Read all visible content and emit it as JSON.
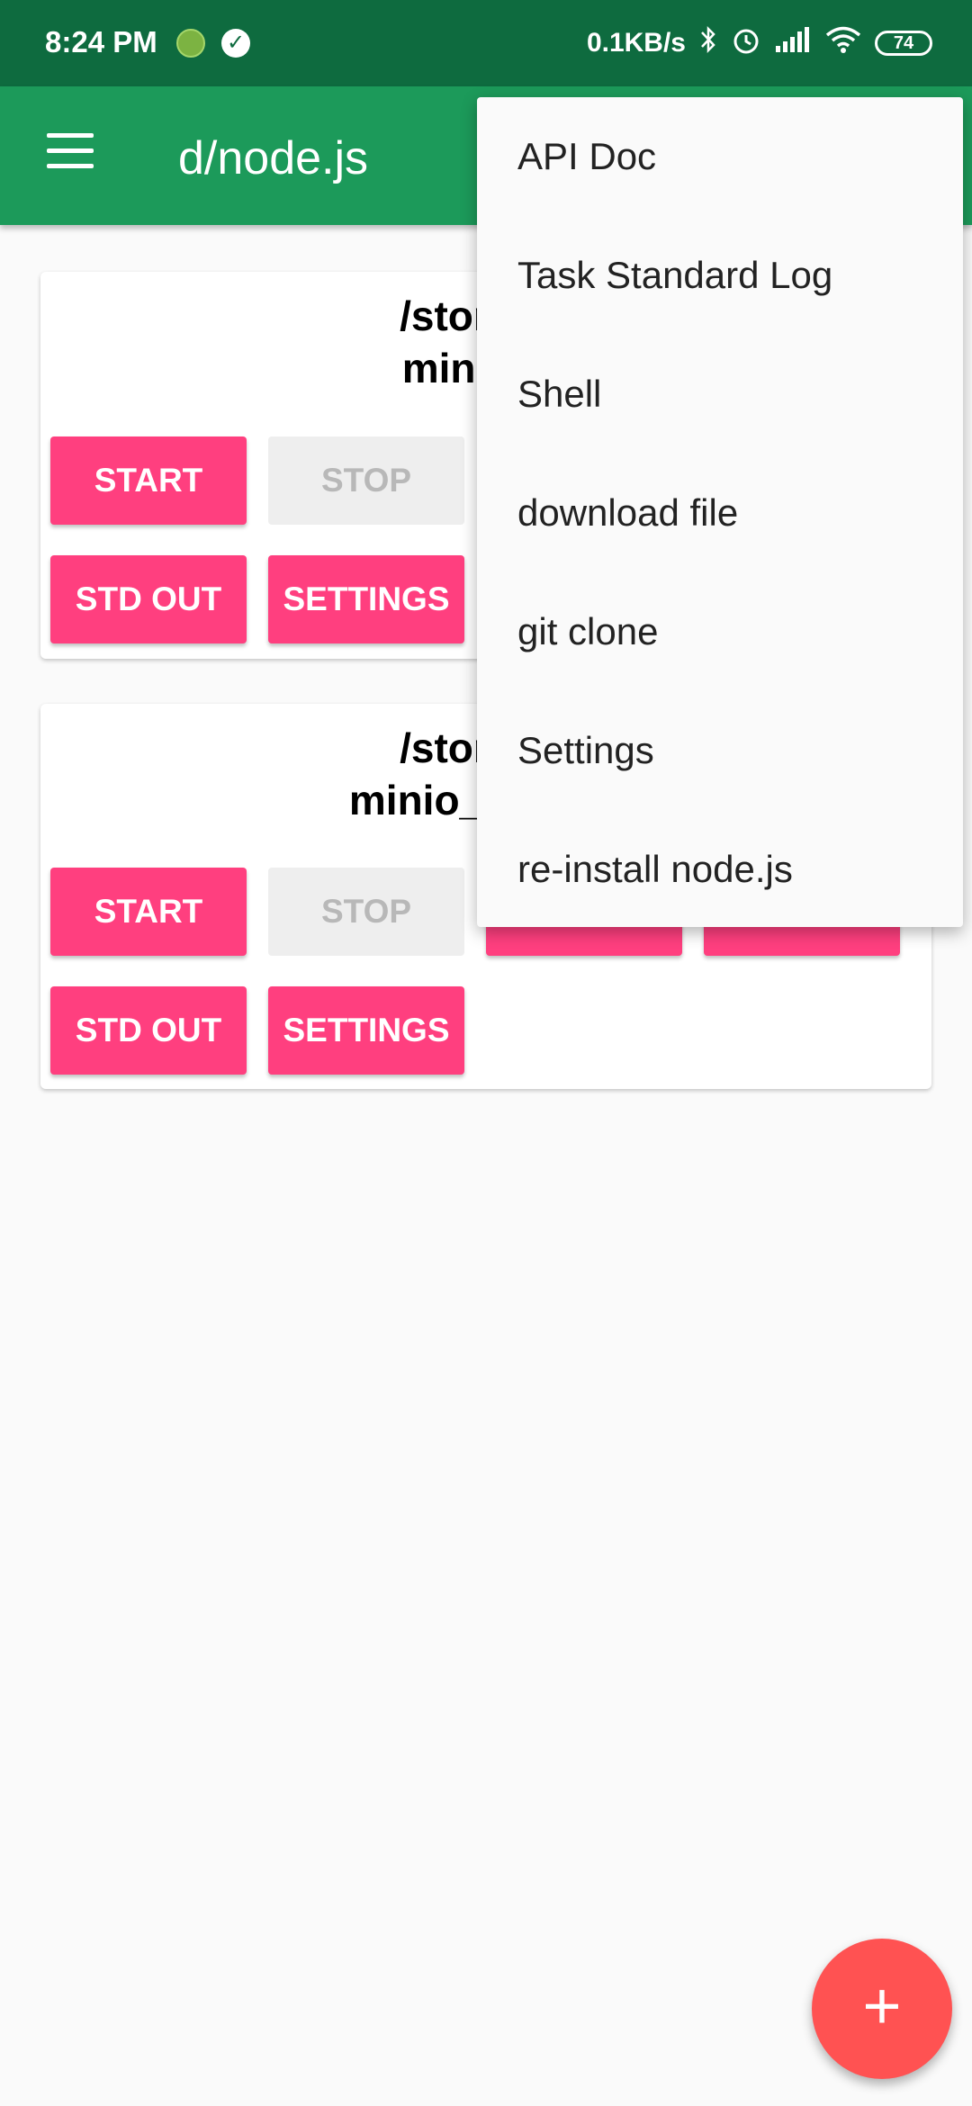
{
  "status_bar": {
    "time": "8:24 PM",
    "network_speed": "0.1KB/s",
    "battery": "74",
    "icons": [
      "app-dot-icon",
      "check-circle-icon",
      "bluetooth-icon",
      "alarm-icon",
      "signal-icon",
      "wifi-icon",
      "battery-icon"
    ]
  },
  "app_bar": {
    "title": "d/node.js",
    "menu_icon": "hamburger-menu-icon"
  },
  "cards": [
    {
      "path_line1": "/storage/",
      "path_line2": "minio_M",
      "buttons": [
        "START",
        "STOP",
        "STD OUT",
        "SETTINGS"
      ]
    },
    {
      "path_line1": "/storage/",
      "path_line2": "minio_Music_",
      "buttons": [
        "START",
        "STOP",
        "STD OUT",
        "SETTINGS"
      ]
    }
  ],
  "overflow_menu": {
    "items": [
      "API Doc",
      "Task Standard Log",
      "Shell",
      "download file",
      "git clone",
      "Settings",
      "re-install node.js"
    ]
  },
  "fab": {
    "icon": "plus-icon",
    "glyph": "+"
  },
  "colors": {
    "status_bar": "#0e6b3f",
    "app_bar": "#1c9a5a",
    "button": "#ff3f7f",
    "fab": "#ff5252"
  }
}
